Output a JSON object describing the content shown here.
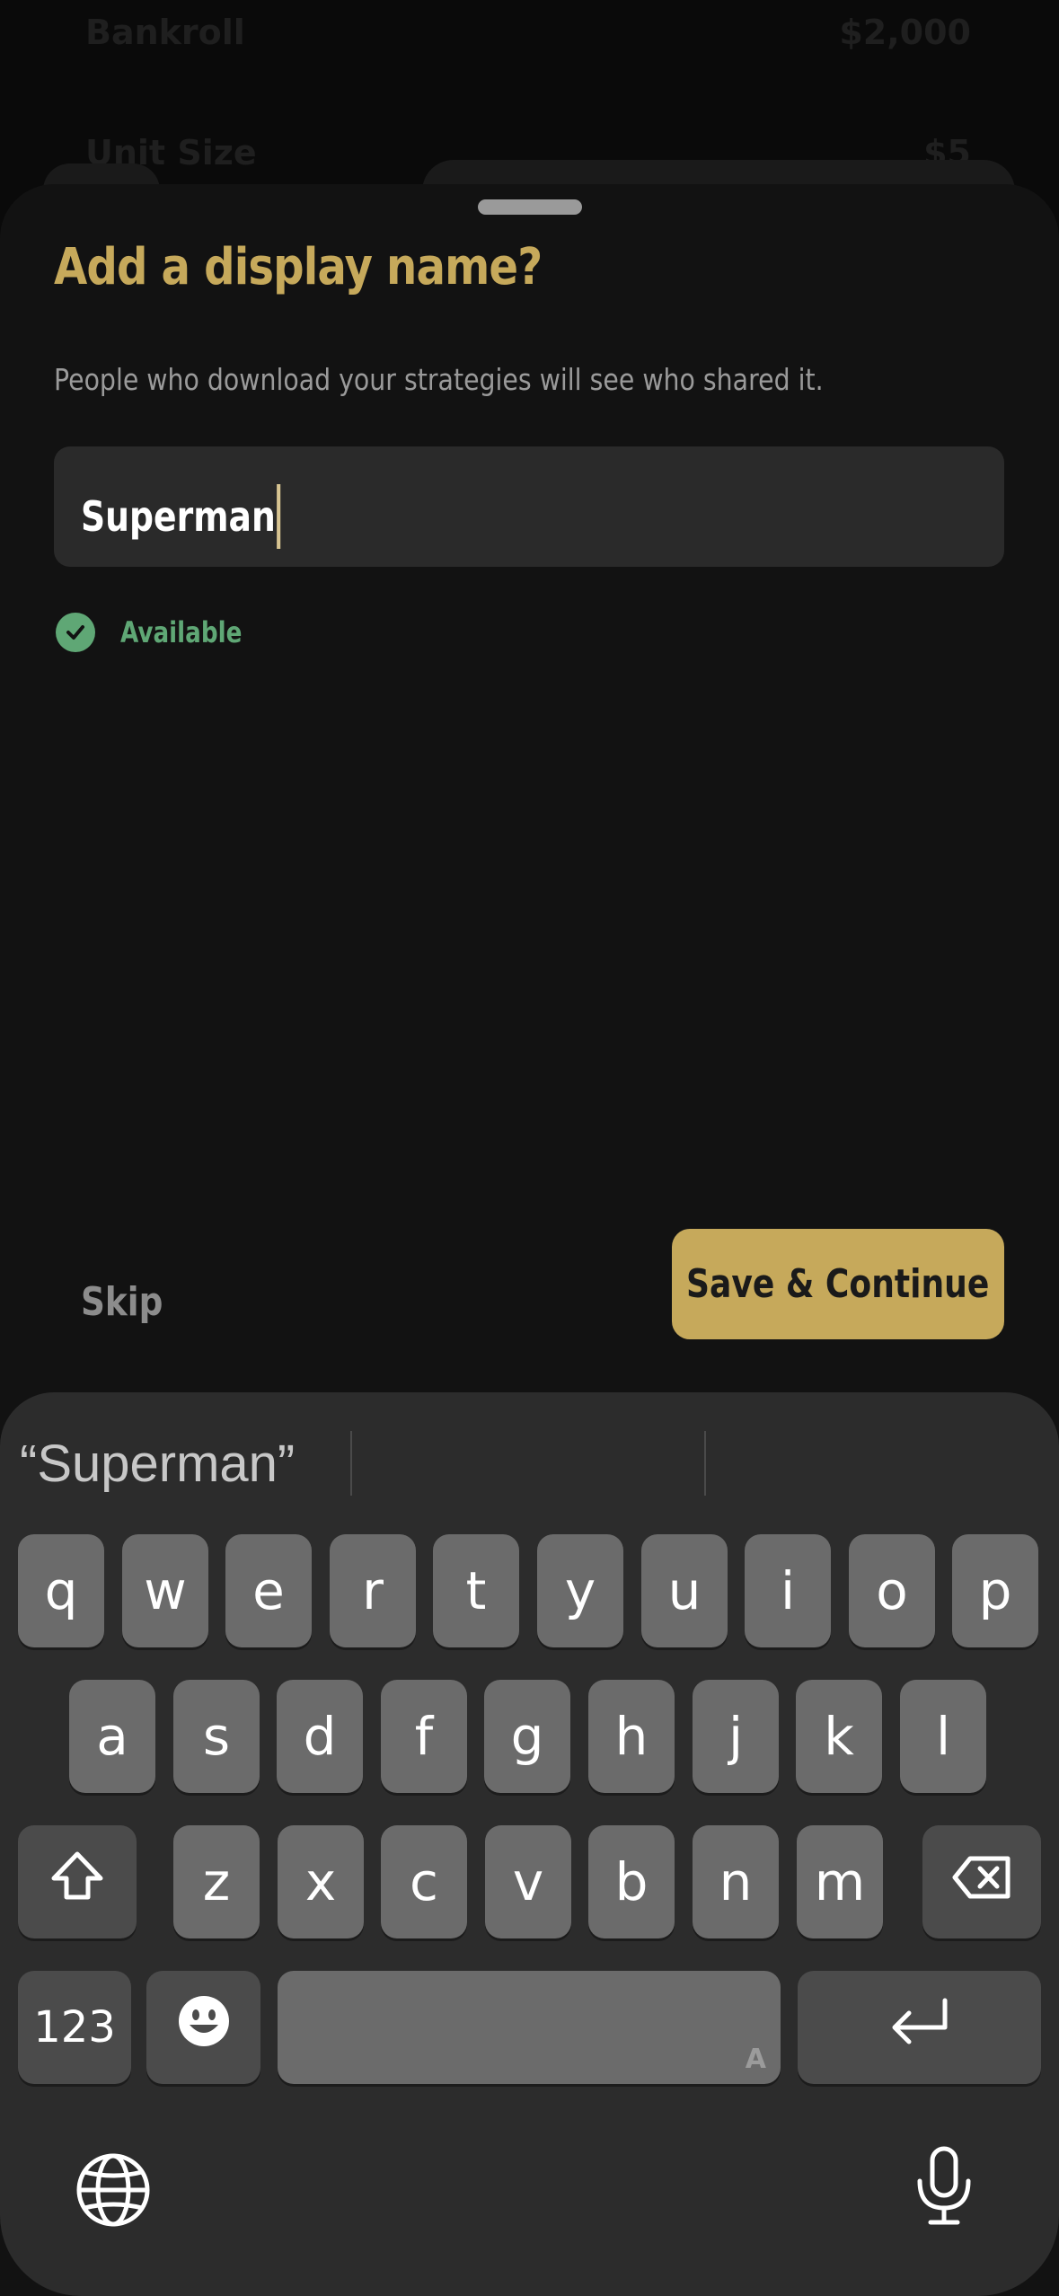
{
  "background": {
    "rows": [
      {
        "label": "Bankroll",
        "value": "$2,000"
      },
      {
        "label": "Unit Size",
        "value": "$5"
      }
    ]
  },
  "sheet": {
    "title": "Add a display name?",
    "subtitle": "People who download your strategies will see who shared it.",
    "name_input_value": "Superman",
    "availability_label": "Available",
    "skip_label": "Skip",
    "save_label": "Save & Continue"
  },
  "keyboard": {
    "suggestion": "“Superman”",
    "row1": [
      "q",
      "w",
      "e",
      "r",
      "t",
      "y",
      "u",
      "i",
      "o",
      "p"
    ],
    "row2": [
      "a",
      "s",
      "d",
      "f",
      "g",
      "h",
      "j",
      "k",
      "l"
    ],
    "row3": [
      "z",
      "x",
      "c",
      "v",
      "b",
      "n",
      "m"
    ],
    "numbers_label": "123",
    "space_corner_label": "A",
    "icons": {
      "shift": "shift-icon",
      "delete": "delete-icon",
      "emoji": "emoji-icon",
      "return": "return-icon",
      "globe": "globe-icon",
      "mic": "microphone-icon"
    }
  },
  "colors": {
    "accent": "#c6a95b",
    "success": "#5fa775",
    "sheet_bg": "#121212",
    "keyboard_bg": "#2c2c2c",
    "key_bg": "#6b6b6b"
  }
}
